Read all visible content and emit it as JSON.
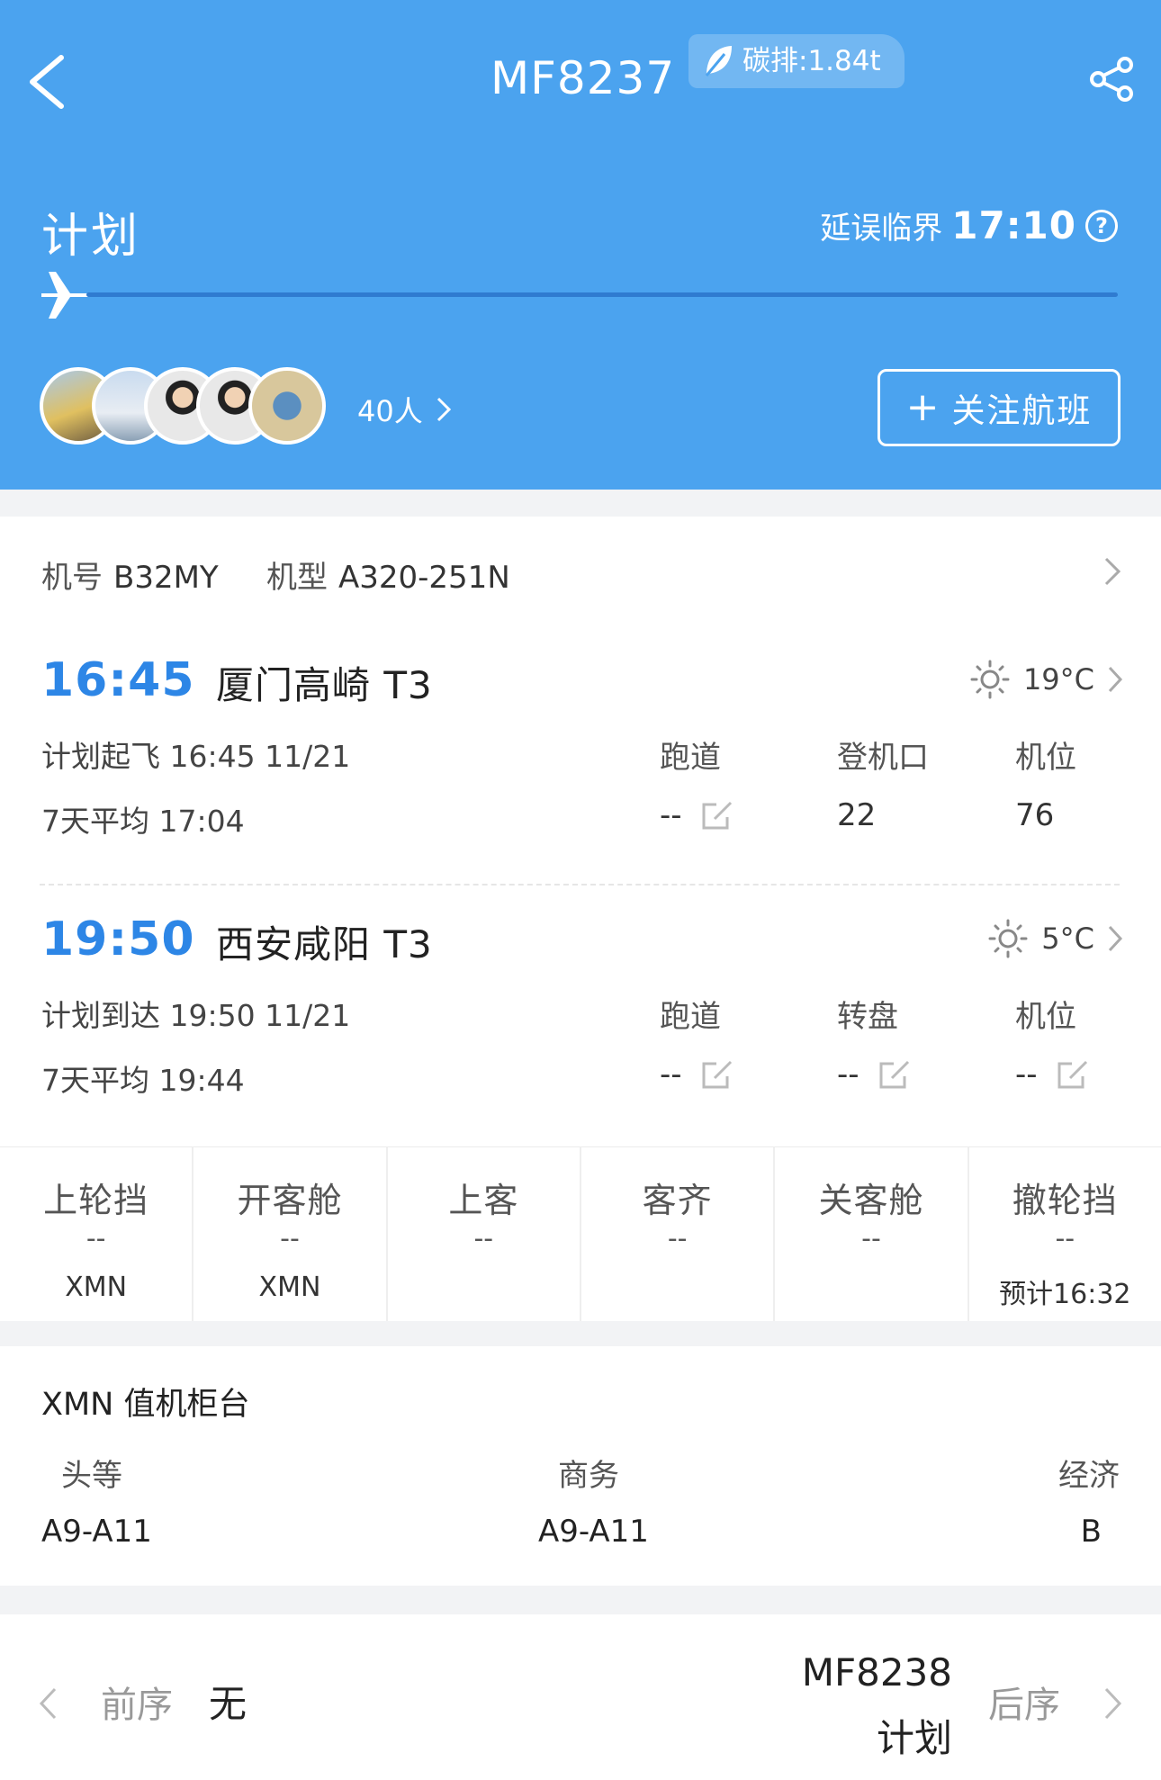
{
  "header": {
    "flight_number": "MF8237",
    "carbon_label": "碳排:1.84t",
    "status": "计划",
    "delay_label": "延误临界",
    "delay_time": "17:10",
    "progress": 0,
    "followers": "40人",
    "follow_button": "关注航班",
    "colors": {
      "background": "#4ba3ef",
      "track": "#2f7bd0"
    }
  },
  "aircraft": {
    "reg_label": "机号",
    "reg_value": "B32MY",
    "type_label": "机型",
    "type_value": "A320-251N"
  },
  "departure": {
    "time": "16:45",
    "airport": "厦门高崎 T3",
    "weather": "19°C",
    "weather_icon": "sun-icon",
    "sched_label": "计划起飞",
    "sched_value": "16:45 11/21",
    "avg_label": "7天平均",
    "avg_value": "17:04",
    "runway_label": "跑道",
    "runway_value": "--",
    "gate_label": "登机口",
    "gate_value": "22",
    "stand_label": "机位",
    "stand_value": "76"
  },
  "arrival": {
    "time": "19:50",
    "airport": "西安咸阳 T3",
    "weather": "5°C",
    "weather_icon": "sun-icon",
    "sched_label": "计划到达",
    "sched_value": "19:50 11/21",
    "avg_label": "7天平均",
    "avg_value": "19:44",
    "runway_label": "跑道",
    "runway_value": "--",
    "carousel_label": "转盘",
    "carousel_value": "--",
    "stand_label": "机位",
    "stand_value": "--"
  },
  "steps": [
    {
      "name": "上轮挡",
      "value": "--",
      "sub": "XMN"
    },
    {
      "name": "开客舱",
      "value": "--",
      "sub": "XMN"
    },
    {
      "name": "上客",
      "value": "--",
      "sub": ""
    },
    {
      "name": "客齐",
      "value": "--",
      "sub": ""
    },
    {
      "name": "关客舱",
      "value": "--",
      "sub": ""
    },
    {
      "name": "撤轮挡",
      "value": "--",
      "sub": "预计16:32"
    }
  ],
  "checkin": {
    "title": "XMN 值机柜台",
    "first_label": "头等",
    "first_value": "A9-A11",
    "business_label": "商务",
    "business_value": "A9-A11",
    "economy_label": "经济",
    "economy_value": "B"
  },
  "sequence": {
    "prev_label": "前序",
    "prev_value": "无",
    "next_flight": "MF8238",
    "next_status": "计划",
    "next_label": "后序"
  }
}
